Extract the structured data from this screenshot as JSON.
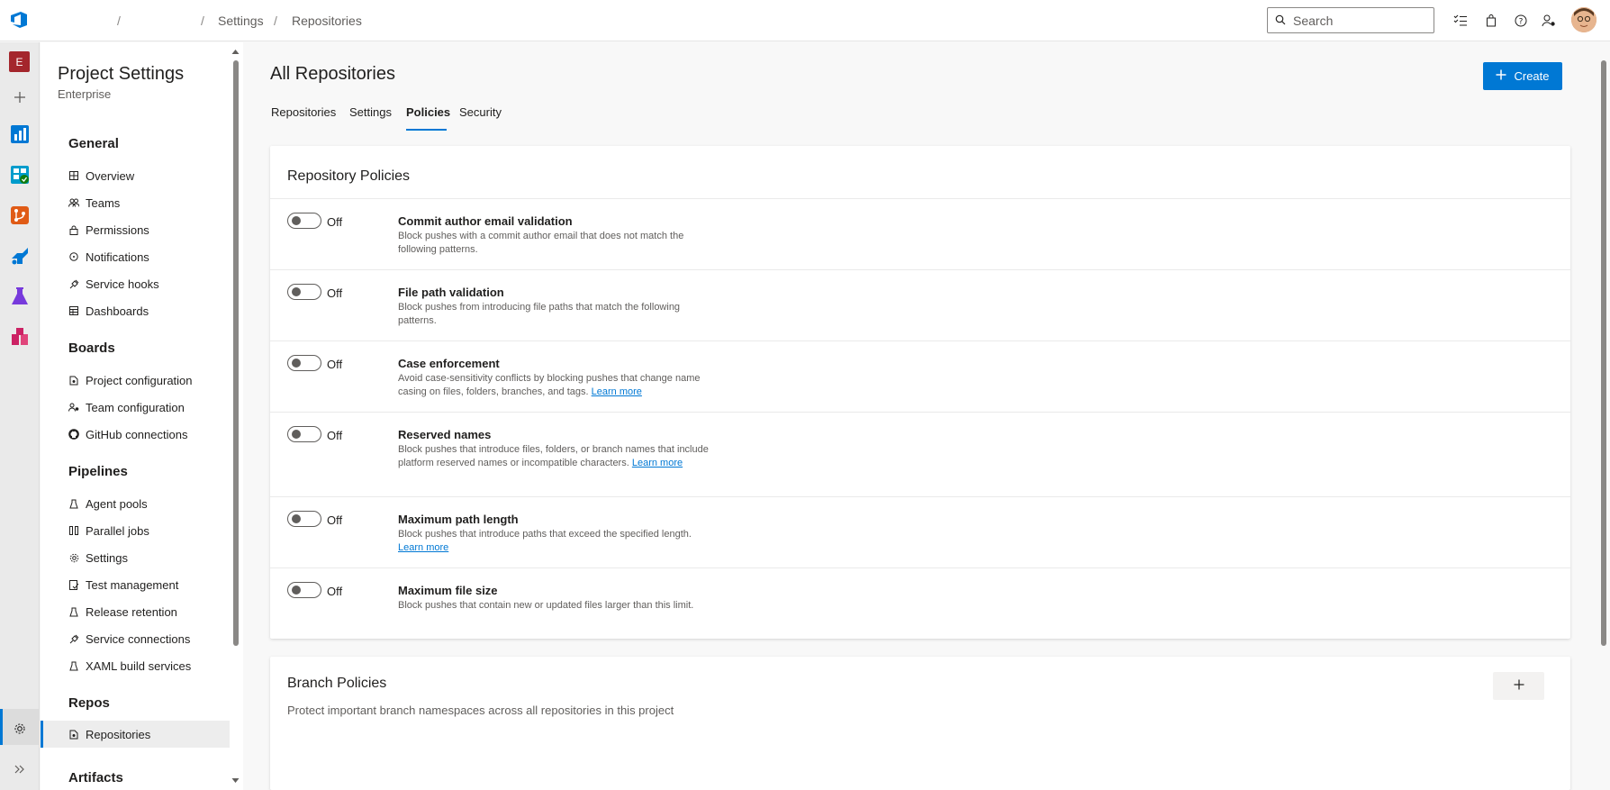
{
  "breadcrumb": {
    "items": [
      "",
      "",
      "Settings",
      "Repositories"
    ]
  },
  "search": {
    "placeholder": "Search"
  },
  "rail": {
    "org_initial": "E"
  },
  "sidebar": {
    "title": "Project Settings",
    "subtitle": "Enterprise",
    "sections": [
      {
        "heading": "General",
        "items": [
          "Overview",
          "Teams",
          "Permissions",
          "Notifications",
          "Service hooks",
          "Dashboards"
        ]
      },
      {
        "heading": "Boards",
        "items": [
          "Project configuration",
          "Team configuration",
          "GitHub connections"
        ]
      },
      {
        "heading": "Pipelines",
        "items": [
          "Agent pools",
          "Parallel jobs",
          "Settings",
          "Test management",
          "Release retention",
          "Service connections",
          "XAML build services"
        ]
      },
      {
        "heading": "Repos",
        "items": [
          "Repositories"
        ]
      },
      {
        "heading": "Artifacts",
        "items": []
      }
    ],
    "selected": "Repositories"
  },
  "main": {
    "title": "All Repositories",
    "create_label": "Create",
    "tabs": [
      "Repositories",
      "Settings",
      "Policies",
      "Security"
    ],
    "active_tab": "Policies",
    "repo_policies": {
      "title": "Repository Policies",
      "off_label": "Off",
      "policies": [
        {
          "name": "Commit author email validation",
          "desc": "Block pushes with a commit author email that does not match the following patterns.",
          "link": "",
          "enabled": false
        },
        {
          "name": "File path validation",
          "desc": "Block pushes from introducing file paths that match the following patterns.",
          "link": "",
          "enabled": false
        },
        {
          "name": "Case enforcement",
          "desc": "Avoid case-sensitivity conflicts by blocking pushes that change name casing on files, folders, branches, and tags.",
          "link": "Learn more",
          "enabled": false
        },
        {
          "name": "Reserved names",
          "desc": "Block pushes that introduce files, folders, or branch names that include platform reserved names or incompatible characters.",
          "link": "Learn more",
          "enabled": false
        },
        {
          "name": "Maximum path length",
          "desc": "Block pushes that introduce paths that exceed the specified length.",
          "link": "Learn more",
          "enabled": false
        },
        {
          "name": "Maximum file size",
          "desc": "Block pushes that contain new or updated files larger than this limit.",
          "link": "",
          "enabled": false
        }
      ]
    },
    "branch_policies": {
      "title": "Branch Policies",
      "subtitle": "Protect important branch namespaces across all repositories in this project"
    }
  },
  "colors": {
    "accent": "#0078d4",
    "org_badge": "#a4262c"
  }
}
